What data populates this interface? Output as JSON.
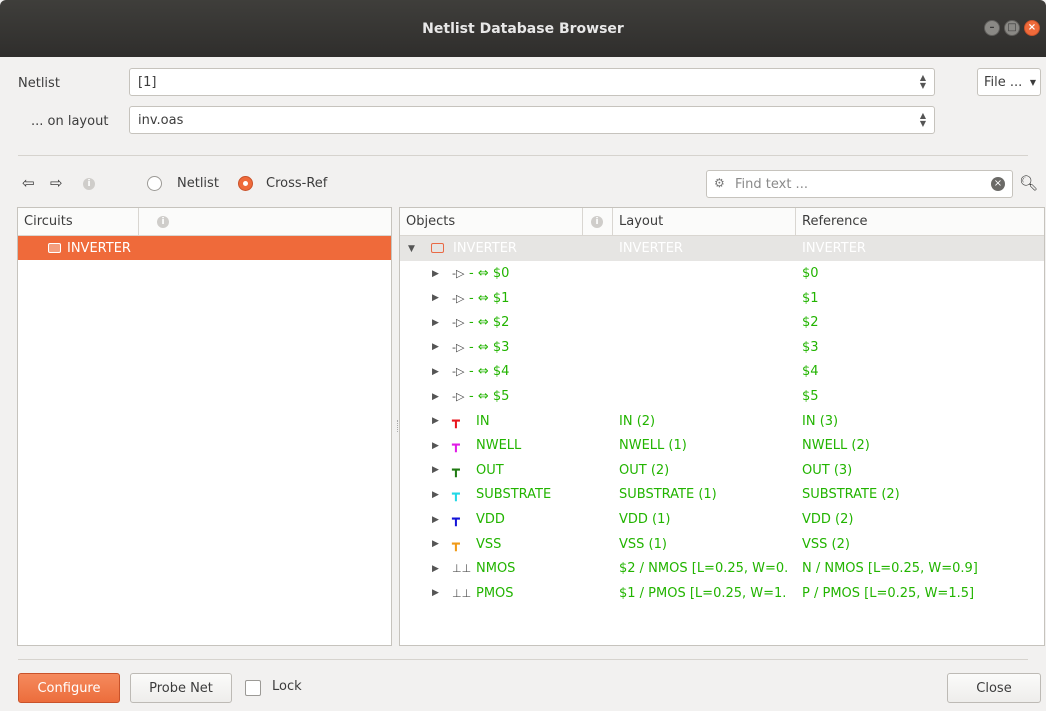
{
  "window": {
    "title": "Netlist Database Browser"
  },
  "netlist": {
    "label": "Netlist",
    "value": "[1]"
  },
  "layout": {
    "label": "... on layout",
    "value": "inv.oas"
  },
  "file_button": "File ...",
  "mode": {
    "netlist_label": "Netlist",
    "crossref_label": "Cross-Ref",
    "selected": "Cross-Ref"
  },
  "search": {
    "placeholder": "Find text ..."
  },
  "circuits": {
    "header": "Circuits",
    "items": [
      {
        "label": "INVERTER"
      }
    ]
  },
  "objects": {
    "headers": {
      "objects": "Objects",
      "layout": "Layout",
      "reference": "Reference"
    },
    "root": {
      "name": "INVERTER",
      "layout": "INVERTER",
      "reference": "INVERTER"
    },
    "rows": [
      {
        "kind": "pin",
        "name": "- ⇔ $0",
        "layout": "",
        "reference": "$0"
      },
      {
        "kind": "pin",
        "name": "- ⇔ $1",
        "layout": "",
        "reference": "$1"
      },
      {
        "kind": "pin",
        "name": "- ⇔ $2",
        "layout": "",
        "reference": "$2"
      },
      {
        "kind": "pin",
        "name": "- ⇔ $3",
        "layout": "",
        "reference": "$3"
      },
      {
        "kind": "pin",
        "name": "- ⇔ $4",
        "layout": "",
        "reference": "$4"
      },
      {
        "kind": "pin",
        "name": "- ⇔ $5",
        "layout": "",
        "reference": "$5"
      },
      {
        "kind": "net",
        "color": "#e8141c",
        "name": "IN",
        "layout": "IN (2)",
        "reference": "IN (3)"
      },
      {
        "kind": "net",
        "color": "#e01ce6",
        "name": "NWELL",
        "layout": "NWELL (1)",
        "reference": "NWELL (2)"
      },
      {
        "kind": "net",
        "color": "#1f7a12",
        "name": "OUT",
        "layout": "OUT (2)",
        "reference": "OUT (3)"
      },
      {
        "kind": "net",
        "color": "#22d8e6",
        "name": "SUBSTRATE",
        "layout": "SUBSTRATE (1)",
        "reference": "SUBSTRATE (2)"
      },
      {
        "kind": "net",
        "color": "#1414d8",
        "name": "VDD",
        "layout": "VDD (1)",
        "reference": "VDD (2)"
      },
      {
        "kind": "net",
        "color": "#f09a18",
        "name": "VSS",
        "layout": "VSS (1)",
        "reference": "VSS (2)"
      },
      {
        "kind": "device",
        "name": "NMOS",
        "layout": "$2 / NMOS [L=0.25, W=0.",
        "reference": "N / NMOS [L=0.25, W=0.9]"
      },
      {
        "kind": "device",
        "name": "PMOS",
        "layout": "$1 / PMOS [L=0.25, W=1.",
        "reference": "P / PMOS [L=0.25, W=1.5]"
      }
    ]
  },
  "footer": {
    "configure": "Configure",
    "probe_net": "Probe Net",
    "lock": "Lock",
    "close": "Close"
  },
  "colors": {
    "accent": "#ef6a3a",
    "match_green": "#22b400"
  }
}
